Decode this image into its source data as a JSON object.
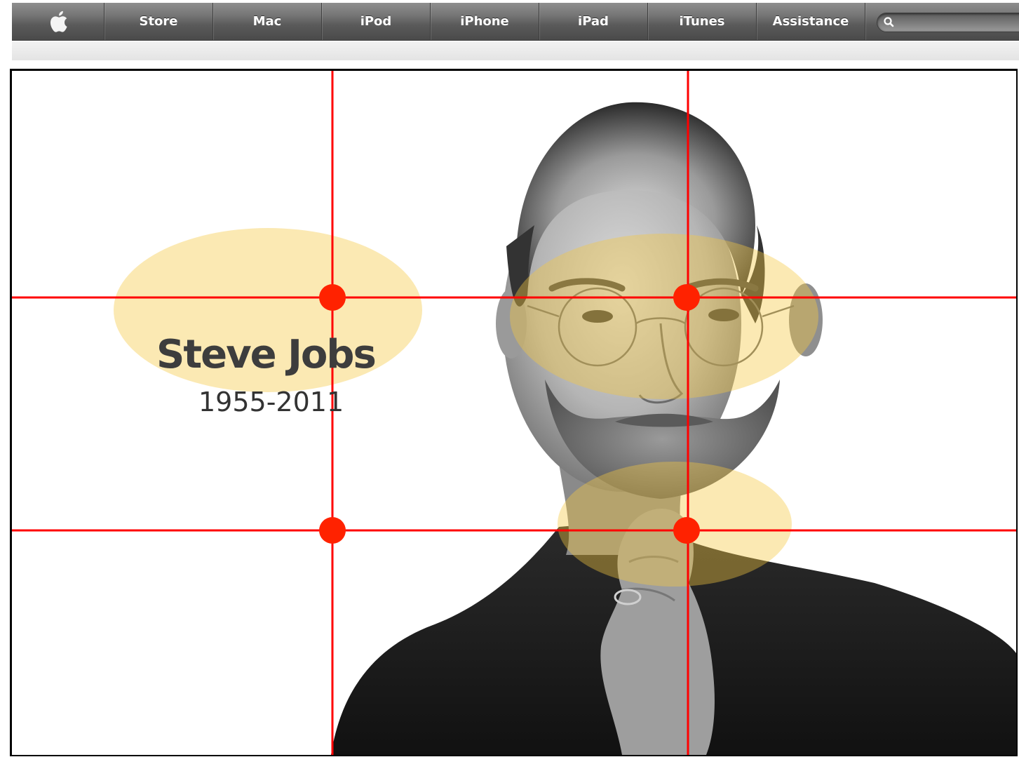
{
  "nav": {
    "apple_icon": "apple-logo-icon",
    "items": [
      {
        "label": "Store"
      },
      {
        "label": "Mac"
      },
      {
        "label": "iPod"
      },
      {
        "label": "iPhone"
      },
      {
        "label": "iPad"
      },
      {
        "label": "iTunes"
      },
      {
        "label": "Assistance"
      }
    ],
    "search": {
      "placeholder": "",
      "value": "",
      "icon": "search-icon"
    }
  },
  "feature": {
    "title": "Steve Jobs",
    "years": "1955-2011"
  },
  "overlay": {
    "grid": "rule-of-thirds",
    "line_color": "#ff0000",
    "highlight_color": "#f5c842",
    "intersections": 4,
    "highlights": 3
  }
}
